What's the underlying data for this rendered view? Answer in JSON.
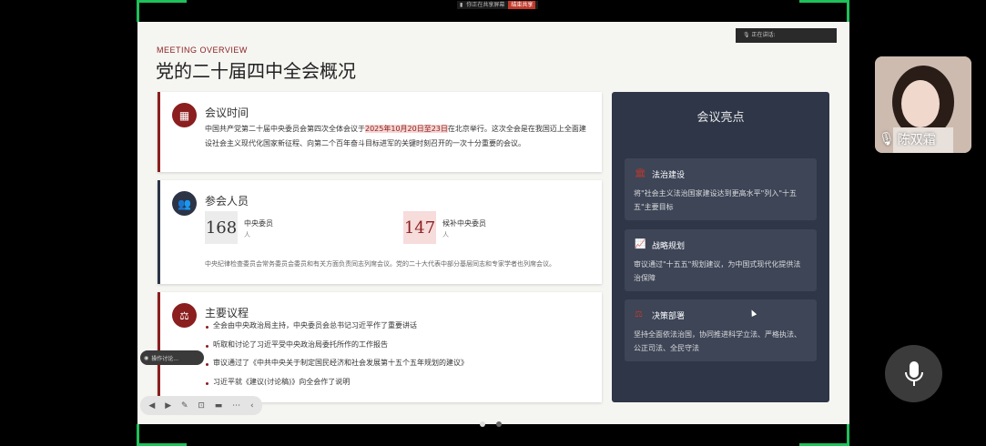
{
  "share_banner": {
    "text": "你正在共享屏幕",
    "stop_label": "结束共享"
  },
  "speaker_bar": {
    "text": "正在讲话:"
  },
  "slide": {
    "kicker": "MEETING OVERVIEW",
    "title": "党的二十届四中全会概况",
    "time_card": {
      "icon": "calendar-icon",
      "title": "会议时间",
      "text_before": "中国共产党第二十届中央委员会第四次全体会议于",
      "date_highlight": "2025年10月20日至23日",
      "text_after": "在北京举行。这次全会是在我国迈上全面建设社会主义现代化国家新征程、向第二个百年奋斗目标进军的关键时刻召开的一次十分重要的会议。"
    },
    "attendee_card": {
      "icon": "people-icon",
      "title": "参会人员",
      "central": {
        "number": "168",
        "label": "中央委员",
        "unit": "人"
      },
      "alternate": {
        "number": "147",
        "label": "候补中央委员",
        "unit": "人"
      },
      "note": "中央纪律检查委员会常务委员会委员和有关方面负责同志列席会议。党的二十大代表中部分基层同志和专家学者也列席会议。"
    },
    "agenda_card": {
      "icon": "gavel-icon",
      "title": "主要议程",
      "items": [
        "全会由中央政治局主持，中央委员会总书记习近平作了重要讲话",
        "听取和讨论了习近平受中央政治局委托所作的工作报告",
        "审议通过了《中共中央关于制定国民经济和社会发展第十五个五年规划的建议》",
        "习近平就《建议(讨论稿)》向全会作了说明"
      ]
    },
    "highlights": {
      "title": "会议亮点",
      "items": [
        {
          "icon": "landmark-icon",
          "title": "法治建设",
          "text": "将\"社会主义法治国家建设达到更高水平\"列入\"十五五\"主要目标"
        },
        {
          "icon": "chart-icon",
          "title": "战略规划",
          "text": "审议通过\"十五五\"规划建议，为中国式现代化提供法治保障"
        },
        {
          "icon": "gavel-icon",
          "title": "决策部署",
          "text": "坚持全面依法治国，协同推进科学立法、严格执法、公正司法、全民守法"
        }
      ]
    }
  },
  "toolbar_top": {
    "label": "操作讨论..."
  },
  "participant": {
    "name": "陈双霜"
  },
  "colors": {
    "accent": "#8b1e1e",
    "navy": "#2c3446",
    "frame_green": "#1fbf5a"
  }
}
